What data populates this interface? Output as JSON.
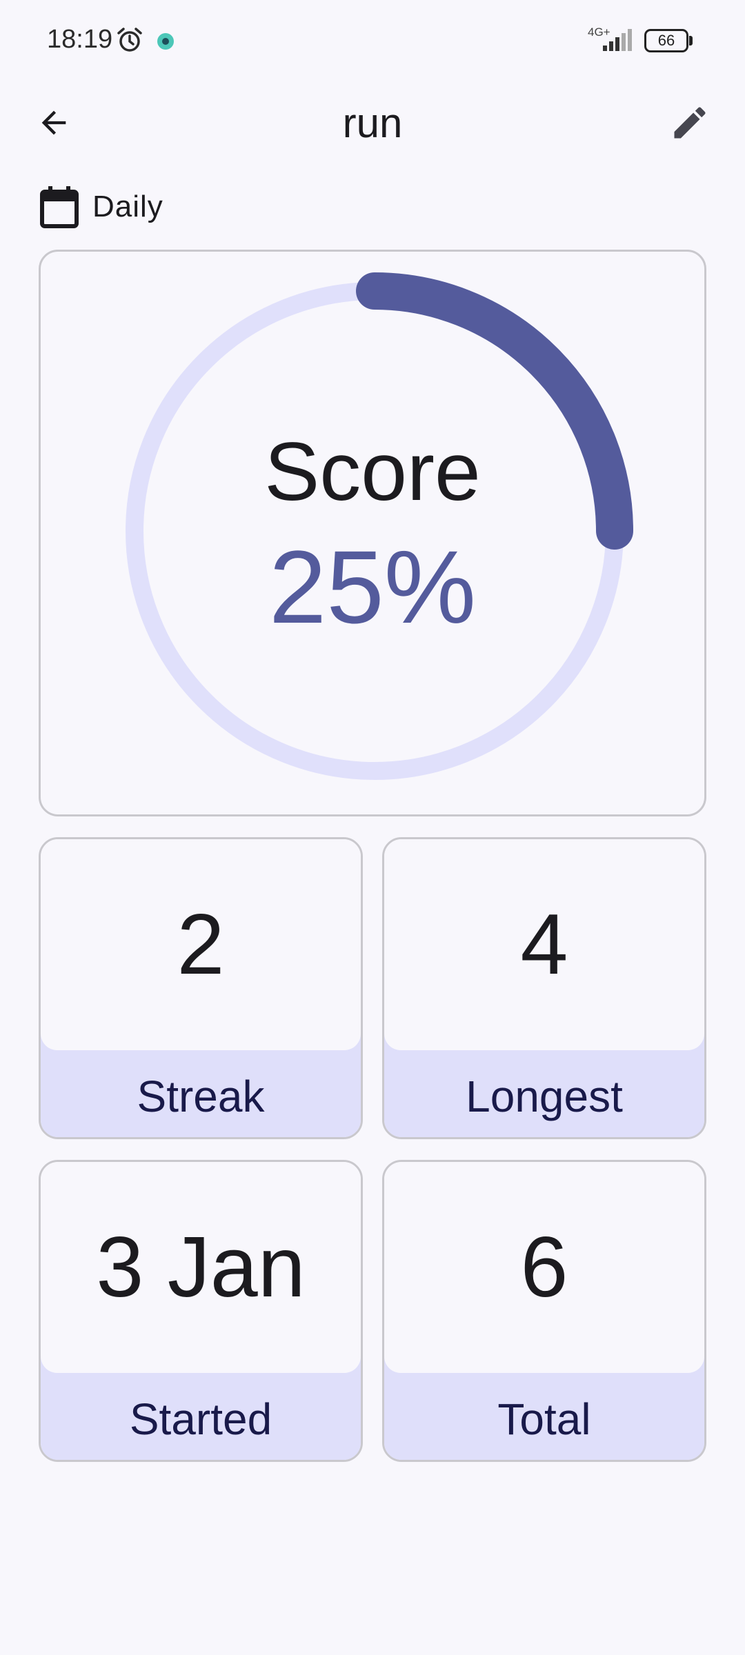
{
  "status_bar": {
    "time": "18:19",
    "network": "4G+",
    "battery": "66",
    "icons": [
      "alarm-icon",
      "app-notification-icon",
      "signal-icon",
      "battery-icon"
    ]
  },
  "app_bar": {
    "title": "run",
    "back_icon": "arrow-back-icon",
    "edit_icon": "pencil-icon"
  },
  "frequency": {
    "icon": "calendar-icon",
    "label": "Daily"
  },
  "score": {
    "label": "Score",
    "value_text": "25%",
    "progress": 0.25
  },
  "stats": [
    {
      "value": "2",
      "label": "Streak"
    },
    {
      "value": "4",
      "label": "Longest"
    },
    {
      "value": "3 Jan",
      "label": "Started"
    },
    {
      "value": "6",
      "label": "Total"
    }
  ],
  "colors": {
    "background": "#f8f7fc",
    "accent": "#545b9c",
    "ring_track": "#e0e0fb",
    "label_band": "#dfdffa",
    "label_text": "#191a4a",
    "card_border": "#c9c8cd"
  }
}
